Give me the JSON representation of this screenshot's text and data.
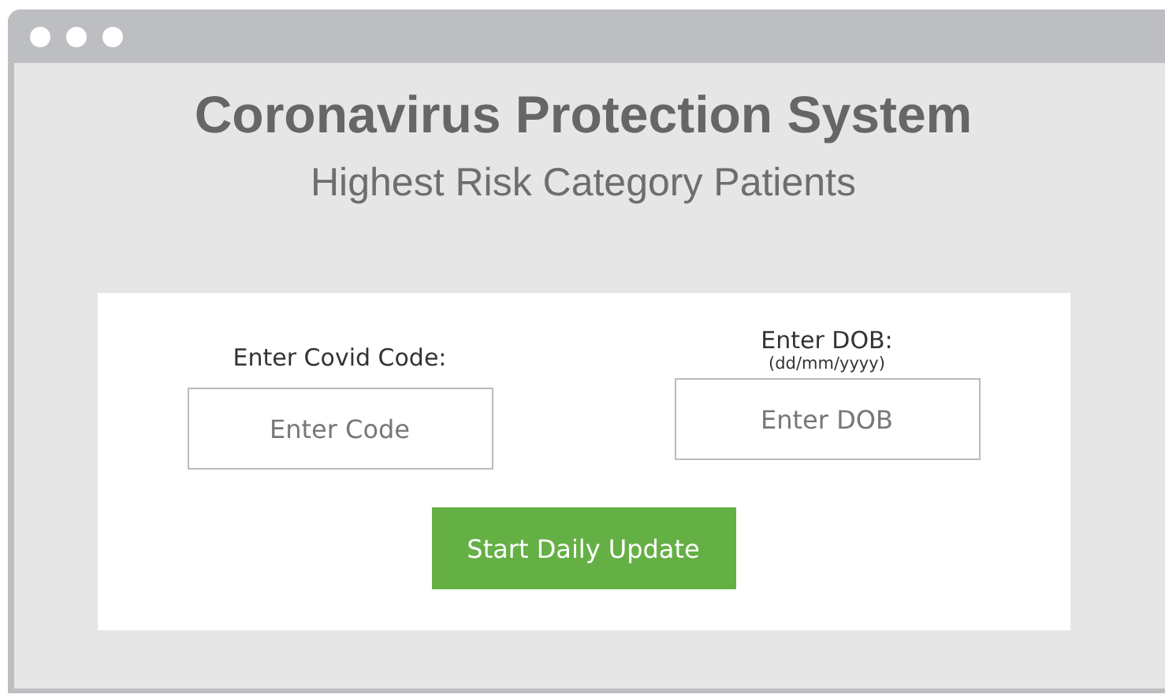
{
  "window": {
    "title": "Coronavirus Protection System",
    "subtitle": "Highest Risk Category Patients"
  },
  "form": {
    "fields": [
      {
        "label": "Enter Covid Code:",
        "placeholder": "Enter Code"
      },
      {
        "label": "Enter DOB:",
        "hint": "(dd/mm/yyyy)",
        "placeholder": "Enter DOB"
      }
    ],
    "button": "Start Daily Update"
  }
}
